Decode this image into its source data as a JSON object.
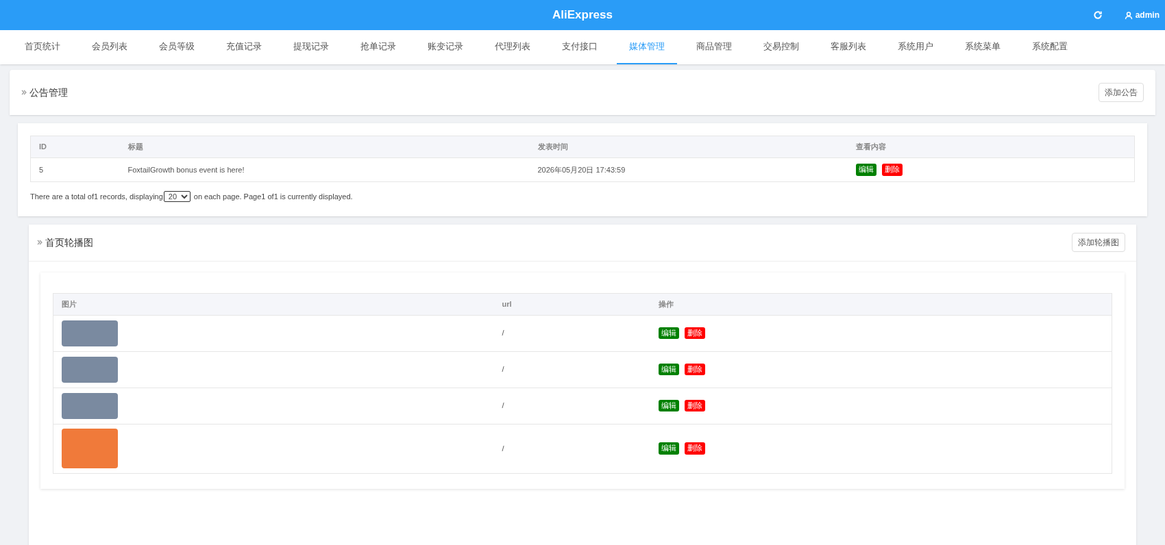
{
  "header": {
    "title": "AliExpress",
    "user": "admin"
  },
  "nav": [
    {
      "label": "首页统计",
      "selected": false
    },
    {
      "label": "会员列表",
      "selected": false
    },
    {
      "label": "会员等级",
      "selected": false
    },
    {
      "label": "充值记录",
      "selected": false
    },
    {
      "label": "提现记录",
      "selected": false
    },
    {
      "label": "抢单记录",
      "selected": false
    },
    {
      "label": "账变记录",
      "selected": false
    },
    {
      "label": "代理列表",
      "selected": false
    },
    {
      "label": "支付接口",
      "selected": false
    },
    {
      "label": "媒体管理",
      "selected": true
    },
    {
      "label": "商品管理",
      "selected": false
    },
    {
      "label": "交易控制",
      "selected": false
    },
    {
      "label": "客服列表",
      "selected": false
    },
    {
      "label": "系统用户",
      "selected": false
    },
    {
      "label": "系统菜单",
      "selected": false
    },
    {
      "label": "系统配置",
      "selected": false
    }
  ],
  "notices": {
    "title": "公告管理",
    "add_button": "添加公告",
    "columns": [
      "ID",
      "标题",
      "发表时间",
      "查看内容"
    ],
    "rows": [
      {
        "id": "5",
        "title": "FoxtailGrowth bonus event is here!",
        "time": "2026年05月20日 17:43:59",
        "edit": "编辑",
        "delete": "删除"
      }
    ],
    "pagination": {
      "before": "There are a total of1 records, displaying",
      "per_page": "20",
      "after": "on each page. Page1 of1 is currently displayed."
    }
  },
  "banners": {
    "title": "首页轮播图",
    "add_button": "添加轮播图",
    "columns": [
      "图片",
      "url",
      "操作"
    ],
    "rows": [
      {
        "url": "/",
        "edit": "编辑",
        "delete": "删除",
        "tall": false
      },
      {
        "url": "/",
        "edit": "编辑",
        "delete": "删除",
        "tall": false
      },
      {
        "url": "/",
        "edit": "编辑",
        "delete": "删除",
        "tall": false
      },
      {
        "url": "/",
        "edit": "编辑",
        "delete": "删除",
        "tall": true
      }
    ]
  }
}
